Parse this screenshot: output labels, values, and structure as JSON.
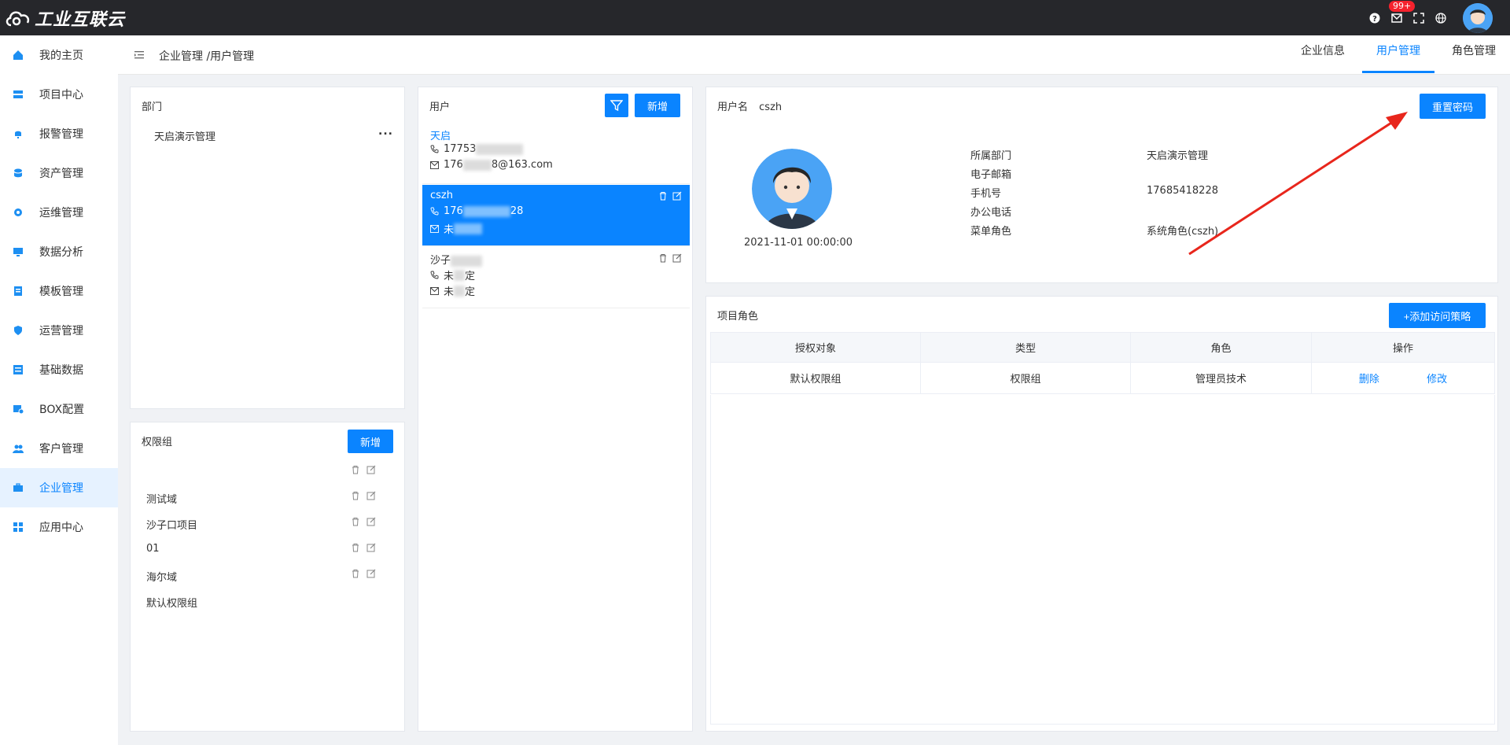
{
  "app": {
    "logo_text": "工业互联云",
    "notif_badge": "99+"
  },
  "sidebar": {
    "items": [
      {
        "label": "我的主页",
        "icon": "home-icon"
      },
      {
        "label": "项目中心",
        "icon": "project-icon"
      },
      {
        "label": "报警管理",
        "icon": "bell-icon"
      },
      {
        "label": "资产管理",
        "icon": "asset-icon"
      },
      {
        "label": "运维管理",
        "icon": "gear-icon"
      },
      {
        "label": "数据分析",
        "icon": "monitor-icon"
      },
      {
        "label": "模板管理",
        "icon": "template-icon"
      },
      {
        "label": "运营管理",
        "icon": "shield-icon"
      },
      {
        "label": "基础数据",
        "icon": "database-icon"
      },
      {
        "label": "BOX配置",
        "icon": "box-icon"
      },
      {
        "label": "客户管理",
        "icon": "users-icon"
      },
      {
        "label": "企业管理",
        "icon": "briefcase-icon",
        "active": true
      },
      {
        "label": "应用中心",
        "icon": "apps-icon"
      }
    ]
  },
  "header": {
    "breadcrumb": "企业管理 /用户管理",
    "tabs": [
      {
        "label": "企业信息"
      },
      {
        "label": "用户管理",
        "active": true
      },
      {
        "label": "角色管理"
      }
    ]
  },
  "dept": {
    "title": "部门",
    "items": [
      "天启演示管理"
    ],
    "more": "..."
  },
  "perm": {
    "title": "权限组",
    "add_label": "新增",
    "rows": [
      "",
      "测试域",
      "沙子口项目",
      "01",
      "海尔域",
      "默认权限组"
    ]
  },
  "users": {
    "title": "用户",
    "add_label": "新增",
    "items": [
      {
        "name": "天启",
        "phone_a": "17753",
        "phone_b": "",
        "email_a": "176",
        "email_b": "8@163.com"
      },
      {
        "name": "cszh",
        "phone_a": "176",
        "phone_b": "28",
        "email_a": "未",
        "email_b": ""
      },
      {
        "name": "沙子",
        "phone_a": "未",
        "phone_b": "定",
        "email_a": "未",
        "email_b": "定"
      }
    ]
  },
  "detail": {
    "username_label": "用户名",
    "username": "cszh",
    "reset_label": "重置密码",
    "created": "2021-11-01 00:00:00",
    "fields": [
      {
        "label": "所属部门",
        "value": "天启演示管理"
      },
      {
        "label": "电子邮箱",
        "value": ""
      },
      {
        "label": "手机号",
        "value": "17685418228"
      },
      {
        "label": "办公电话",
        "value": ""
      },
      {
        "label": "菜单角色",
        "value": "系统角色(cszh)"
      }
    ]
  },
  "project_roles": {
    "title": "项目角色",
    "add_label": "+添加访问策略",
    "columns": [
      "授权对象",
      "类型",
      "角色",
      "操作"
    ],
    "rows": [
      {
        "target": "默认权限组",
        "type": "权限组",
        "role": "管理员技术",
        "delete": "删除",
        "edit": "修改"
      }
    ]
  },
  "colors": {
    "accent": "#0a84ff",
    "topbar": "#26272b",
    "badge": "#f5222d",
    "arrow": "#e8261c"
  }
}
